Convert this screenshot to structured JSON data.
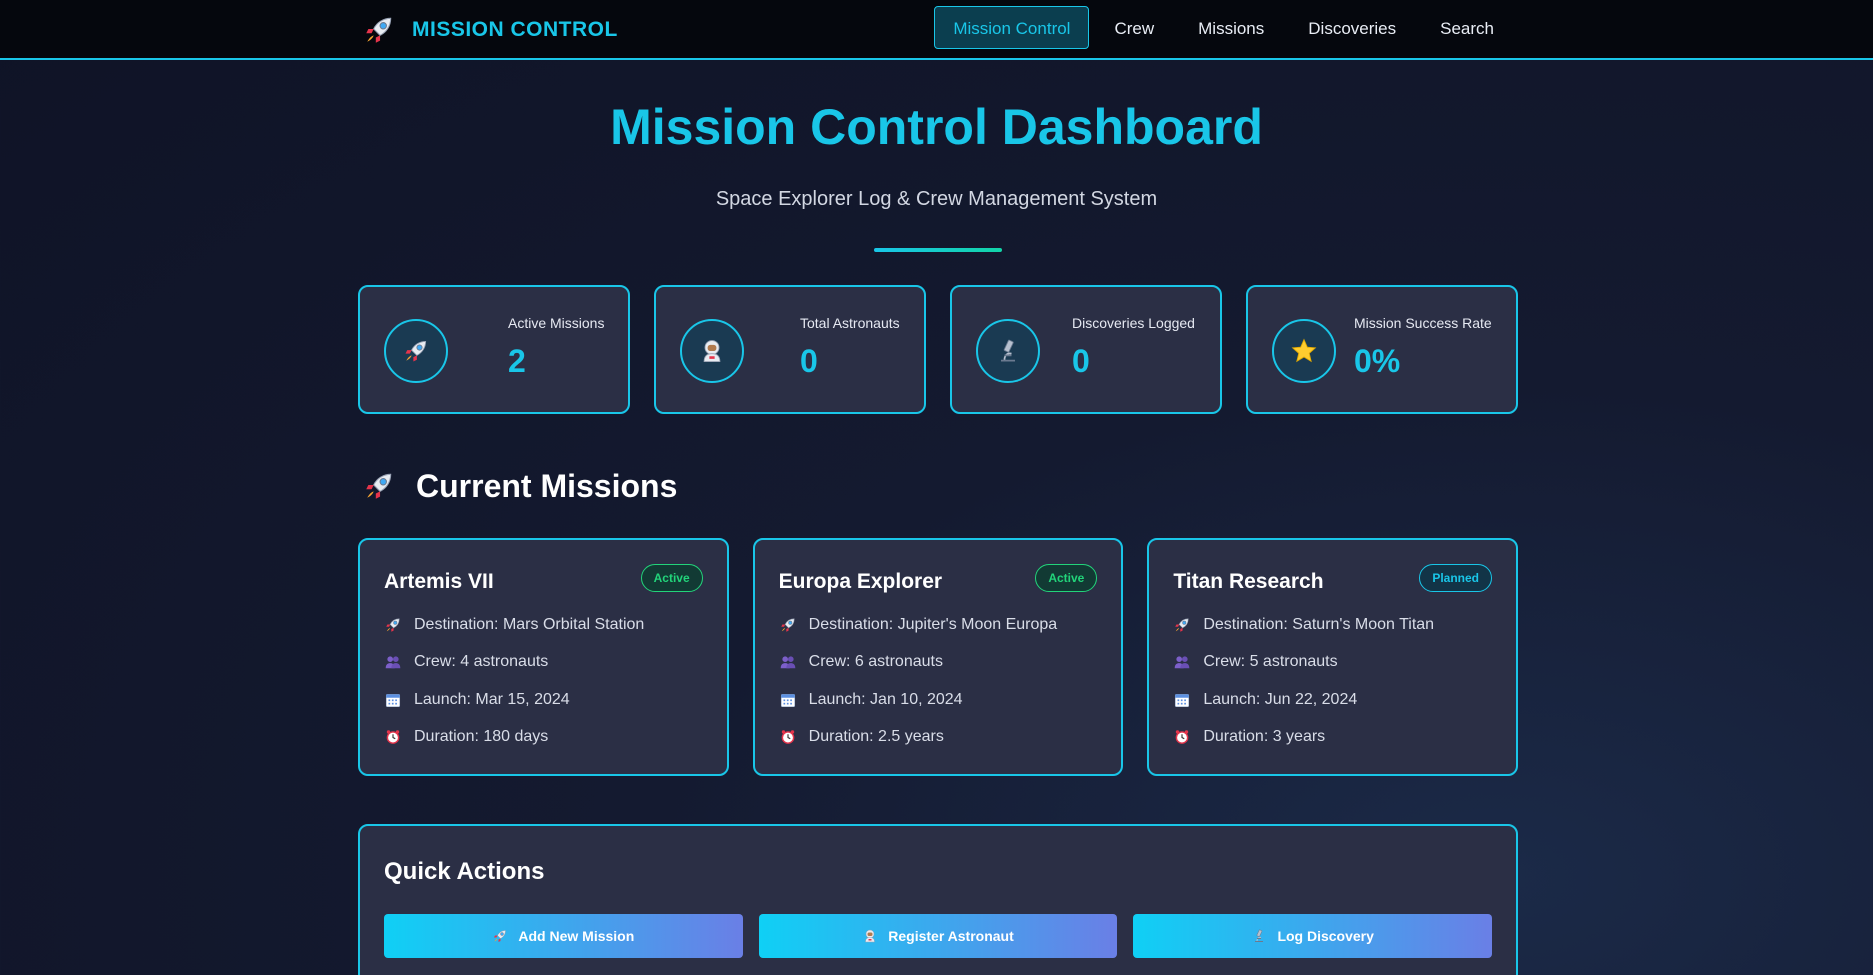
{
  "navbar": {
    "brand": "MISSION CONTROL",
    "brand_icon": "rocket-icon",
    "links": [
      {
        "label": "Mission Control",
        "active": true
      },
      {
        "label": "Crew"
      },
      {
        "label": "Missions"
      },
      {
        "label": "Discoveries"
      },
      {
        "label": "Search"
      }
    ]
  },
  "hero": {
    "title": "Mission Control Dashboard",
    "subtitle": "Space Explorer Log & Crew Management System"
  },
  "stats": [
    {
      "label": "Active Missions",
      "value": "2",
      "icon": "rocket-icon"
    },
    {
      "label": "Total Astronauts",
      "value": "0",
      "icon": "astronaut-icon"
    },
    {
      "label": "Discoveries Logged",
      "value": "0",
      "icon": "microscope-icon"
    },
    {
      "label": "Mission Success Rate",
      "value": "0%",
      "icon": "star-icon"
    }
  ],
  "missions_section": {
    "title": "Current Missions",
    "icon": "rocket-icon"
  },
  "missions": [
    {
      "name": "Artemis VII",
      "status": "Active",
      "destination": "Destination: Mars Orbital Station",
      "crew": "Crew: 4 astronauts",
      "launch": "Launch: Mar 15, 2024",
      "duration": "Duration: 180 days"
    },
    {
      "name": "Europa Explorer",
      "status": "Active",
      "destination": "Destination: Jupiter's Moon Europa",
      "crew": "Crew: 6 astronauts",
      "launch": "Launch: Jan 10, 2024",
      "duration": "Duration: 2.5 years"
    },
    {
      "name": "Titan Research",
      "status": "Planned",
      "destination": "Destination: Saturn's Moon Titan",
      "crew": "Crew: 5 astronauts",
      "launch": "Launch: Jun 22, 2024",
      "duration": "Duration: 3 years"
    }
  ],
  "quick_actions": {
    "title": "Quick Actions",
    "buttons": [
      {
        "label": "Add New Mission",
        "icon": "rocket-icon"
      },
      {
        "label": "Register Astronaut",
        "icon": "astronaut-icon"
      },
      {
        "label": "Log Discovery",
        "icon": "microscope-icon"
      }
    ]
  },
  "colors": {
    "accent": "#19c6e8",
    "active_badge": "#22d47a",
    "card_bg": "#2b2f45",
    "nav_bg": "#05070d"
  }
}
